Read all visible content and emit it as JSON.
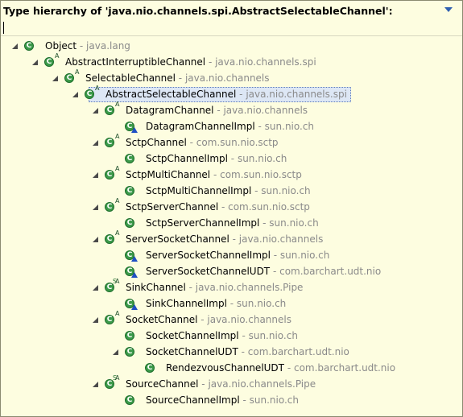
{
  "header": {
    "title": "Type hierarchy of 'java.nio.channels.spi.AbstractSelectableChannel':"
  },
  "filter": {
    "value": ""
  },
  "tree": [
    {
      "name": "Object",
      "pkg": " - java.lang",
      "depth": 0,
      "expanded": true,
      "abstract": false,
      "final": false,
      "static": false,
      "impl": false
    },
    {
      "name": "AbstractInterruptibleChannel",
      "pkg": " - java.nio.channels.spi",
      "depth": 1,
      "expanded": true,
      "abstract": true,
      "final": false,
      "static": false,
      "impl": false
    },
    {
      "name": "SelectableChannel",
      "pkg": " - java.nio.channels",
      "depth": 2,
      "expanded": true,
      "abstract": true,
      "final": false,
      "static": false,
      "impl": false
    },
    {
      "name": "AbstractSelectableChannel",
      "pkg": " - java.nio.channels.spi",
      "depth": 3,
      "expanded": true,
      "abstract": true,
      "final": false,
      "static": false,
      "impl": false,
      "selected": true
    },
    {
      "name": "DatagramChannel",
      "pkg": " - java.nio.channels",
      "depth": 4,
      "expanded": true,
      "abstract": true,
      "final": false,
      "static": false,
      "impl": false
    },
    {
      "name": "DatagramChannelImpl",
      "pkg": " - sun.nio.ch",
      "depth": 5,
      "expanded": false,
      "abstract": false,
      "final": false,
      "static": false,
      "impl": true
    },
    {
      "name": "SctpChannel",
      "pkg": " - com.sun.nio.sctp",
      "depth": 4,
      "expanded": true,
      "abstract": true,
      "final": false,
      "static": false,
      "impl": false
    },
    {
      "name": "SctpChannelImpl",
      "pkg": " - sun.nio.ch",
      "depth": 5,
      "expanded": false,
      "abstract": false,
      "final": false,
      "static": false,
      "impl": false
    },
    {
      "name": "SctpMultiChannel",
      "pkg": " - com.sun.nio.sctp",
      "depth": 4,
      "expanded": true,
      "abstract": true,
      "final": false,
      "static": false,
      "impl": false
    },
    {
      "name": "SctpMultiChannelImpl",
      "pkg": " - sun.nio.ch",
      "depth": 5,
      "expanded": false,
      "abstract": false,
      "final": false,
      "static": false,
      "impl": false
    },
    {
      "name": "SctpServerChannel",
      "pkg": " - com.sun.nio.sctp",
      "depth": 4,
      "expanded": true,
      "abstract": true,
      "final": false,
      "static": false,
      "impl": false
    },
    {
      "name": "SctpServerChannelImpl",
      "pkg": " - sun.nio.ch",
      "depth": 5,
      "expanded": false,
      "abstract": false,
      "final": false,
      "static": false,
      "impl": false
    },
    {
      "name": "ServerSocketChannel",
      "pkg": " - java.nio.channels",
      "depth": 4,
      "expanded": true,
      "abstract": true,
      "final": false,
      "static": false,
      "impl": false
    },
    {
      "name": "ServerSocketChannelImpl",
      "pkg": " - sun.nio.ch",
      "depth": 5,
      "expanded": false,
      "abstract": false,
      "final": false,
      "static": false,
      "impl": true
    },
    {
      "name": "ServerSocketChannelUDT",
      "pkg": " - com.barchart.udt.nio",
      "depth": 5,
      "expanded": false,
      "abstract": false,
      "final": false,
      "static": false,
      "impl": true
    },
    {
      "name": "SinkChannel",
      "pkg": " - java.nio.channels.Pipe",
      "depth": 4,
      "expanded": true,
      "abstract": true,
      "final": false,
      "static": true,
      "impl": false
    },
    {
      "name": "SinkChannelImpl",
      "pkg": " - sun.nio.ch",
      "depth": 5,
      "expanded": false,
      "abstract": false,
      "final": false,
      "static": false,
      "impl": true
    },
    {
      "name": "SocketChannel",
      "pkg": " - java.nio.channels",
      "depth": 4,
      "expanded": true,
      "abstract": true,
      "final": false,
      "static": false,
      "impl": false
    },
    {
      "name": "SocketChannelImpl",
      "pkg": " - sun.nio.ch",
      "depth": 5,
      "expanded": false,
      "abstract": false,
      "final": false,
      "static": false,
      "impl": false
    },
    {
      "name": "SocketChannelUDT",
      "pkg": " - com.barchart.udt.nio",
      "depth": 5,
      "expanded": true,
      "abstract": false,
      "final": false,
      "static": false,
      "impl": false
    },
    {
      "name": "RendezvousChannelUDT",
      "pkg": " - com.barchart.udt.nio",
      "depth": 6,
      "expanded": false,
      "abstract": false,
      "final": false,
      "static": false,
      "impl": false
    },
    {
      "name": "SourceChannel",
      "pkg": " - java.nio.channels.Pipe",
      "depth": 4,
      "expanded": true,
      "abstract": true,
      "final": false,
      "static": true,
      "impl": false
    },
    {
      "name": "SourceChannelImpl",
      "pkg": " - sun.nio.ch",
      "depth": 5,
      "expanded": false,
      "abstract": false,
      "final": false,
      "static": false,
      "impl": false
    }
  ],
  "colors": {
    "background": "#fdfde0",
    "package_text": "#8a8a8a",
    "class_icon": "#3c9a4a",
    "header_arrow": "#2f5fb0"
  },
  "icons": {
    "class": "class-icon",
    "abstract_marker": "A",
    "static_marker": "S",
    "interface_impl_marker": "triangle-icon",
    "expander": "expanded-twistie-icon",
    "view_menu": "view-menu-icon"
  }
}
